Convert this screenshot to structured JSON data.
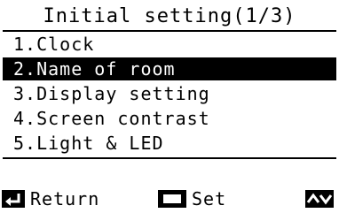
{
  "header": {
    "title": "Initial setting(1/3)"
  },
  "menu": {
    "items": [
      {
        "label": "1.Clock",
        "selected": false
      },
      {
        "label": "2.Name of room",
        "selected": true
      },
      {
        "label": "3.Display setting",
        "selected": false
      },
      {
        "label": "4.Screen contrast",
        "selected": false
      },
      {
        "label": "5.Light & LED",
        "selected": false
      }
    ]
  },
  "footer": {
    "return_label": "Return",
    "return_icon": "return-arrow-icon",
    "set_label": "Set",
    "set_icon": "set-square-icon",
    "navigate_icon": "up-down-arrows-icon"
  },
  "colors": {
    "background": "#ffffff",
    "foreground": "#000000",
    "highlight_bg": "#000000",
    "highlight_fg": "#ffffff"
  }
}
